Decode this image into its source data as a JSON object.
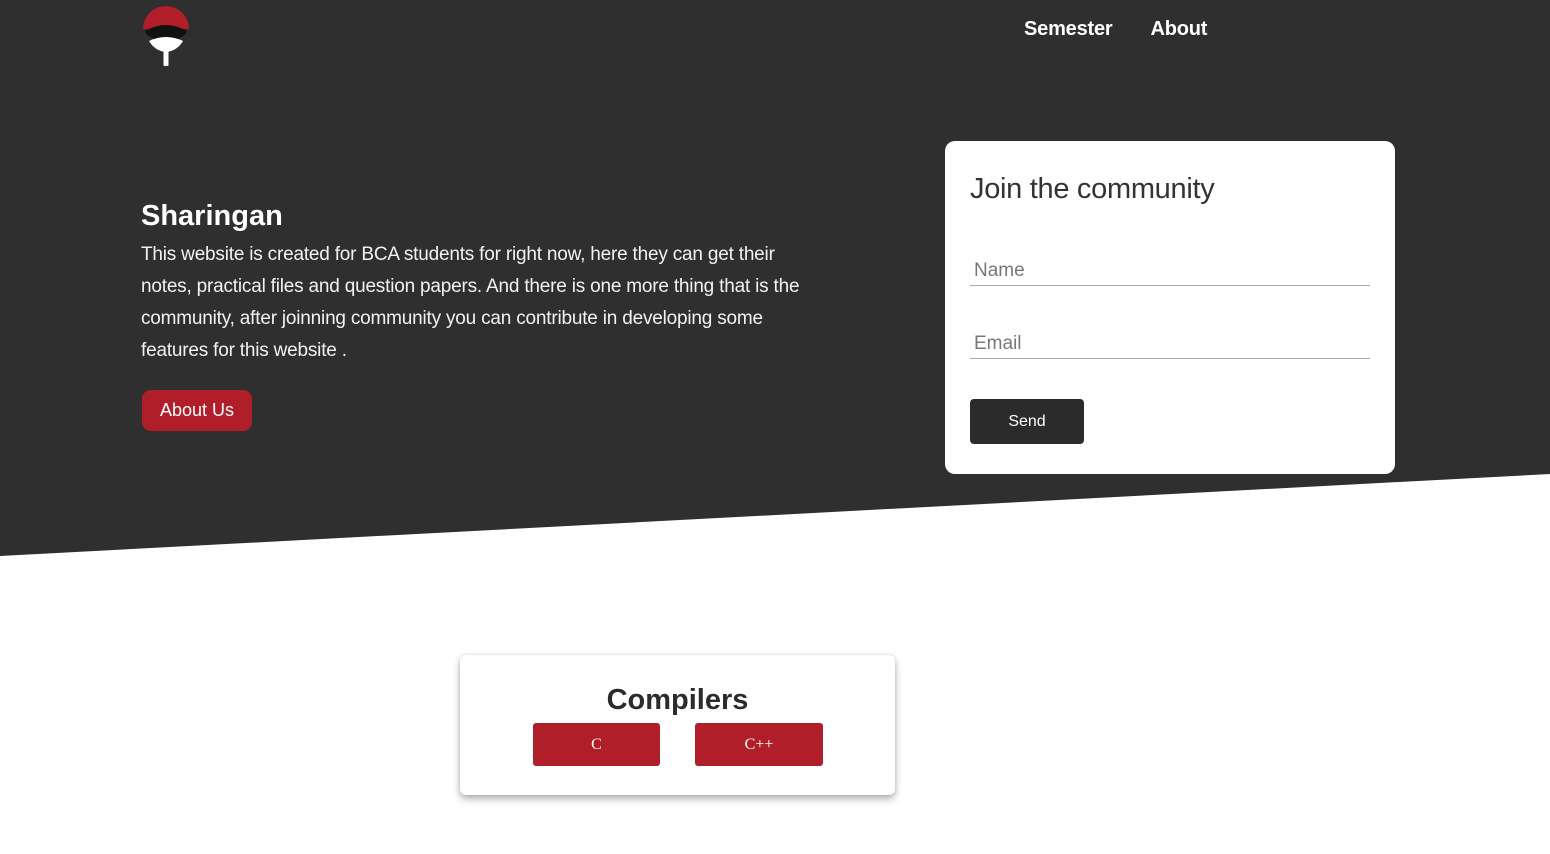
{
  "nav": {
    "semester": "Semester",
    "about": "About"
  },
  "logo": {
    "icon": "uchiha-fan-icon"
  },
  "hero": {
    "title": "Sharingan",
    "description": "This website is created for BCA students for right now, here they can get their notes, practical files and question papers. And there is one more thing that is the community, after joinning community you can contribute in developing some features for this website .",
    "about_button": "About Us"
  },
  "join": {
    "title": "Join the community",
    "name_placeholder": "Name",
    "email_placeholder": "Email",
    "send_label": "Send"
  },
  "compilers": {
    "title": "Compilers",
    "buttons": [
      "C",
      "C++"
    ]
  },
  "colors": {
    "hero_bg": "#2f2f2f",
    "accent_red": "#b01f29",
    "send_bg": "#2b2b2b"
  }
}
